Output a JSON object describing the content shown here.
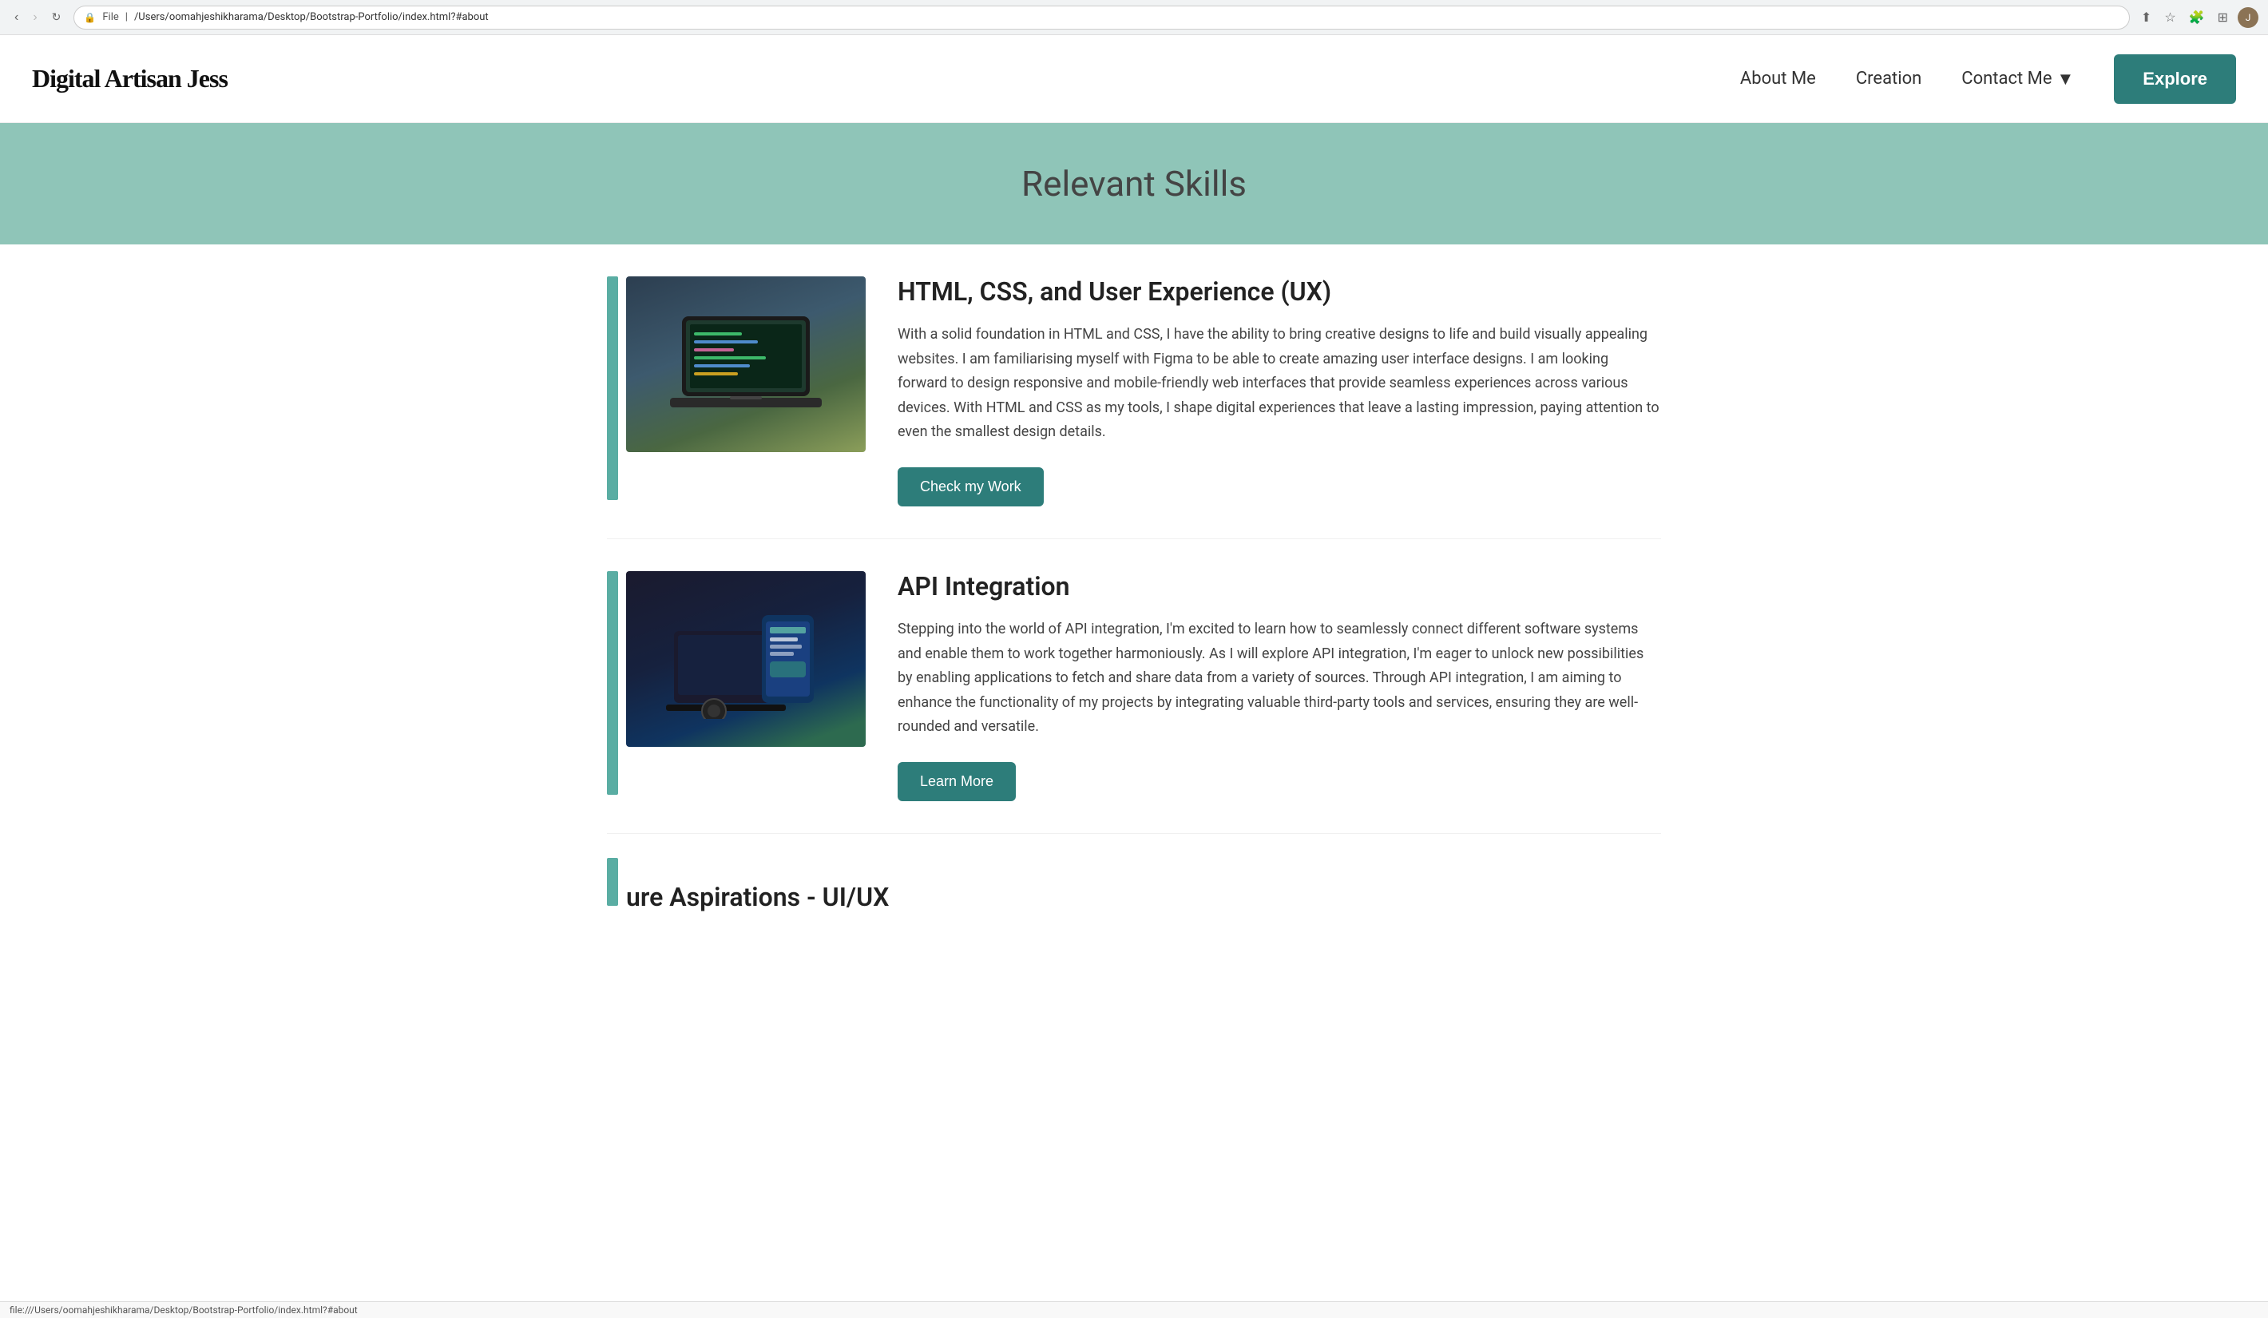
{
  "browser": {
    "url": "/Users/oomahjeshikharama/Desktop/Bootstrap-Portfolio/index.html?#about",
    "file_label": "File",
    "full_url": "file:///Users/oomahjeshikharama/Desktop/Bootstrap-Portfolio/index.html?#about",
    "status_text": "file:///Users/oomahjeshikharama/Desktop/Bootstrap-Portfolio/index.html?#about"
  },
  "navbar": {
    "brand": "Digital Artisan Jess",
    "about_label": "About Me",
    "creation_label": "Creation",
    "contact_label": "Contact Me",
    "explore_label": "Explore"
  },
  "skills_header": {
    "title": "Relevant Skills"
  },
  "skills": [
    {
      "id": "html-css-ux",
      "title": "HTML, CSS, and User Experience (UX)",
      "description": "With a solid foundation in HTML and CSS, I have the ability to bring creative designs to life and build visually appealing websites. I am familiarising myself with Figma to be able to create amazing user interface designs. I am looking forward to design responsive and mobile-friendly web interfaces that provide seamless experiences across various devices. With HTML and CSS as my tools, I shape digital experiences that leave a lasting impression, paying attention to even the smallest design details.",
      "button_label": "Check my Work",
      "image_type": "laptop"
    },
    {
      "id": "api-integration",
      "title": "API Integration",
      "description": "Stepping into the world of API integration, I'm excited to learn how to seamlessly connect different software systems and enable them to work together harmoniously. As I will explore API integration, I'm eager to unlock new possibilities by enabling applications to fetch and share data from a variety of sources. Through API integration, I am aiming to enhance the functionality of my projects by integrating valuable third-party tools and services, ensuring they are well-rounded and versatile.",
      "button_label": "Learn More",
      "image_type": "phone"
    }
  ],
  "partial_section": {
    "title": "ure Aspirations - UI/UX"
  },
  "icons": {
    "back": "‹",
    "forward": "›",
    "reload": "↻",
    "lock": "🔒",
    "share": "⬆",
    "bookmark": "☆",
    "extension": "🧩",
    "grid": "⊞",
    "dropdown_arrow": "▼"
  },
  "colors": {
    "teal_accent": "#5aada3",
    "teal_dark": "#2d7d7a",
    "skills_bg": "#8fc5b8"
  }
}
